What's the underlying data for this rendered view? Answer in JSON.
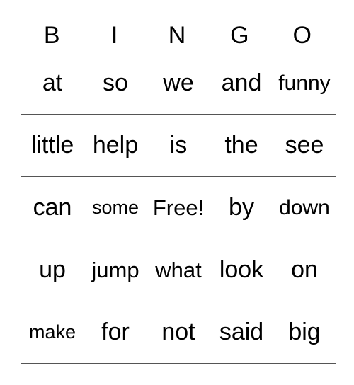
{
  "header": {
    "letters": [
      "B",
      "I",
      "N",
      "G",
      "O"
    ]
  },
  "card": {
    "rows": [
      [
        "at",
        "so",
        "we",
        "and",
        "funny"
      ],
      [
        "little",
        "help",
        "is",
        "the",
        "see"
      ],
      [
        "can",
        "some",
        "Free!",
        "by",
        "down"
      ],
      [
        "up",
        "jump",
        "what",
        "look",
        "on"
      ],
      [
        "make",
        "for",
        "not",
        "said",
        "big"
      ]
    ]
  }
}
